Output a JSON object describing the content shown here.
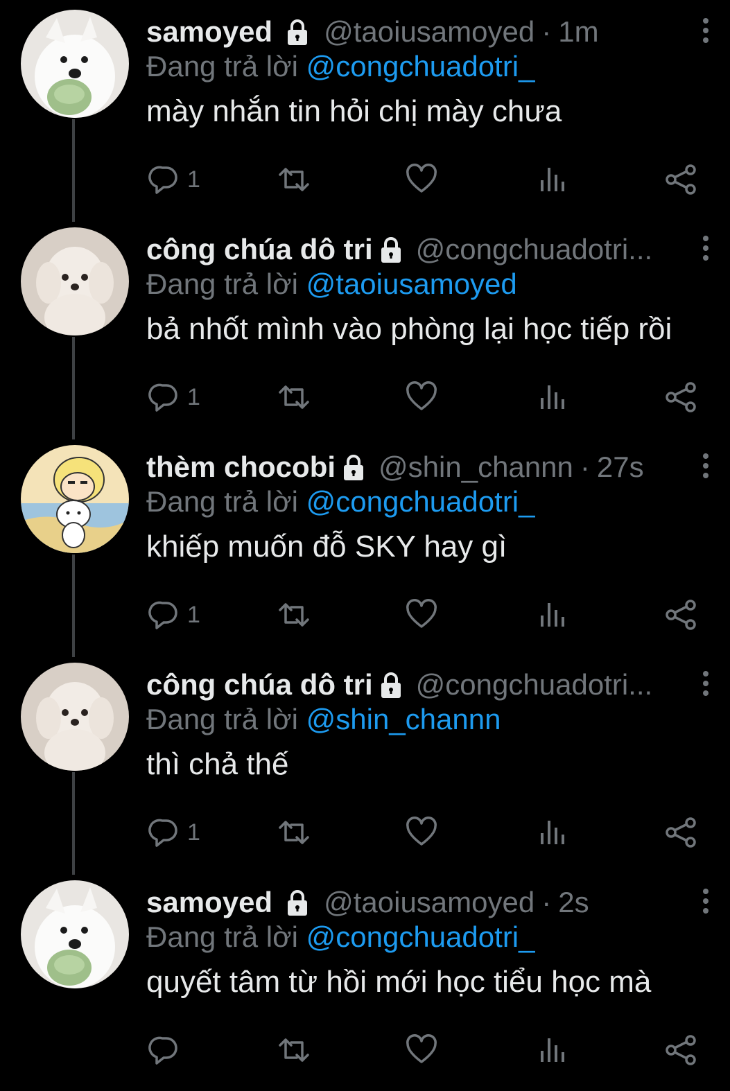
{
  "colors": {
    "background": "#000000",
    "text": "#e7e9ea",
    "muted": "#71767b",
    "mention": "#1d9bf0",
    "thread_line": "#3e4144"
  },
  "lock_icon": "lock-icon",
  "replying_prefix": "Đang trả lời ",
  "tweets": [
    {
      "avatar": "samoyed-dog-avatar",
      "display_name": "samoyed",
      "handle": "@taoiusamoyed",
      "separator": "·",
      "time": "1m",
      "replying_to": "@congchuadotri_",
      "text": "mày nhắn tin hỏi chị mày chưa",
      "reply_count": "1"
    },
    {
      "avatar": "white-poodle-avatar",
      "display_name": "công chúa dô tri",
      "handle": "@congchuadotri...",
      "separator": "",
      "time": "",
      "replying_to": "@taoiusamoyed",
      "text": "bả nhốt mình vào phòng lại học tiếp rồi",
      "reply_count": "1"
    },
    {
      "avatar": "cartoon-avatar",
      "display_name": "thèm chocobi",
      "handle": "@shin_channn",
      "separator": "·",
      "time": "27s",
      "replying_to": "@congchuadotri_",
      "text": "khiếp muốn đỗ SKY hay gì",
      "reply_count": "1"
    },
    {
      "avatar": "white-poodle-avatar",
      "display_name": "công chúa dô tri",
      "handle": "@congchuadotri...",
      "separator": "",
      "time": "",
      "replying_to": "@shin_channn",
      "text": "thì chả thế",
      "reply_count": "1"
    },
    {
      "avatar": "samoyed-dog-avatar",
      "display_name": "samoyed",
      "handle": "@taoiusamoyed",
      "separator": "·",
      "time": "2s",
      "replying_to": "@congchuadotri_",
      "text": "quyết tâm từ hồi mới học tiểu học mà",
      "reply_count": ""
    }
  ]
}
